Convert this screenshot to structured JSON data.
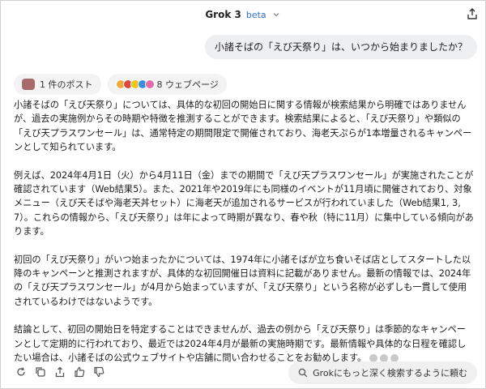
{
  "header": {
    "model_name": "Grok 3",
    "beta_label": "beta",
    "icons": {
      "dropdown": "chevron-down-icon",
      "share": "share-icon"
    }
  },
  "conversation": {
    "user_message": "小諸そばの「えび天祭り」は、いつから始まりましたか？",
    "sources": {
      "posts_label": "1 件のポスト",
      "web_label": "8 ウェブページ"
    },
    "answer_paragraphs": [
      "小諸そばの「えび天祭り」については、具体的な初回の開始日に関する情報が検索結果から明確ではありませんが、過去の実施例からその時期や特徴を推測することができます。検索結果によると、「えび天祭り」や類似の「えび天プラスワンセール」は、通常特定の期間限定で開催されており、海老天ぷらが1本増量されるキャンペーンとして知られています。",
      "例えば、2024年4月1日（火）から4月11日（金）までの期間で「えび天プラスワンセール」が実施されたことが確認されています（Web結果5）。また、2021年や2019年にも同様のイベントが11月頃に開催されており、対象メニュー（えび天そばや海老天丼セット）に海老天が追加されるサービスが行われていました（Web結果1, 3, 7）。これらの情報から、「えび天祭り」は年によって時期が異なり、春や秋（特に11月）に集中している傾向があります。",
      "初回の「えび天祭り」がいつ始まったかについては、1974年に小諸そばが立ち食いそば店としてスタートした以降のキャンペーンと推測されますが、具体的な初回開催日は資料に記載がありません。最新の情報では、2024年の「えび天プラスワンセール」が4月から始まっていますが、「えび天祭り」という名称が必ずしも一貫して使用されているわけではないようです。",
      "結論として、初回の開始日を特定することはできませんが、過去の例から「えび天祭り」は季節的なキャンペーンとして定期的に行われており、最近では2024年4月が最新の実施時期です。最新情報や具体的な日程を確認したい場合は、小諸そばの公式ウェブサイトや店舗に問い合わせることをお勧めします。"
    ]
  },
  "footer": {
    "deeper_search_label": "Grokにもっと深く検索するように頼む",
    "action_icons": [
      "regenerate-icon",
      "copy-icon",
      "share-icon",
      "thumbs-up-icon",
      "thumbs-down-icon"
    ]
  },
  "colors": {
    "beta": "#2f6fd6",
    "bubble": "#eeeff1",
    "chip": "#f3f3f4"
  }
}
